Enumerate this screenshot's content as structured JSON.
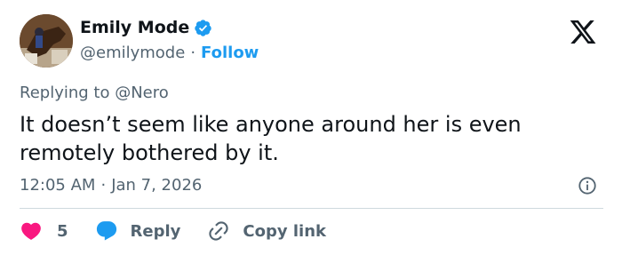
{
  "author": {
    "display_name": "Emily Mode",
    "handle": "@emilymode",
    "follow_label": "Follow",
    "separator": "·"
  },
  "reply_to": "Replying to @Nero",
  "tweet_text": "It doesn’t seem like anyone around her is even remotely bothered by it.",
  "meta": {
    "time": "12:05 AM",
    "separator": "·",
    "date": "Jan 7, 2026"
  },
  "actions": {
    "like_count": "5",
    "reply_label": "Reply",
    "copy_label": "Copy link"
  },
  "colors": {
    "accent": "#1d9bf0",
    "heart": "#f91880",
    "text": "#0f1419",
    "muted": "#536471"
  },
  "icons": [
    "avatar-photo",
    "verified-badge-icon",
    "x-logo-icon",
    "info-icon",
    "heart-icon",
    "reply-bubble-icon",
    "link-icon"
  ]
}
